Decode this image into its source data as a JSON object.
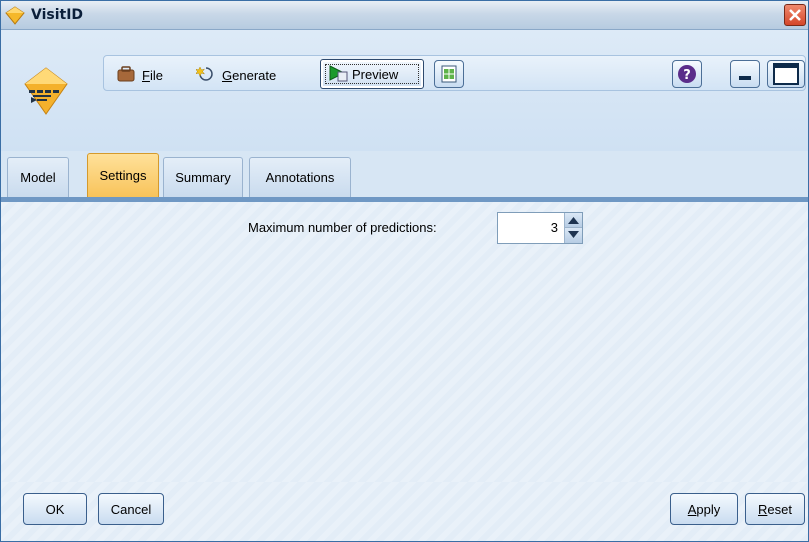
{
  "window": {
    "title": "VisitID"
  },
  "toolbar": {
    "file_label": "File",
    "file_mnemonic": "F",
    "file_rest": "ile",
    "generate_mnemonic": "G",
    "generate_rest": "enerate",
    "preview_mnemonic": "P",
    "preview_rest": "review"
  },
  "tabs": [
    {
      "label": "Model"
    },
    {
      "label": "Settings",
      "active": true
    },
    {
      "label": "Summary"
    },
    {
      "label": "Annotations"
    }
  ],
  "settings": {
    "max_predictions_label": "Maximum number of predictions:",
    "max_predictions_value": "3"
  },
  "buttons": {
    "ok": "OK",
    "cancel": "Cancel",
    "apply_mnemonic": "A",
    "apply_rest": "pply",
    "reset_mnemonic": "R",
    "reset_rest": "eset"
  },
  "icons": {
    "title": "model-nugget-icon",
    "close": "close-icon",
    "file": "file-icon",
    "generate": "generate-icon",
    "preview": "preview-icon",
    "export": "export-icon",
    "help": "help-icon",
    "minimize": "minimize-icon",
    "maximize": "maximize-icon"
  },
  "colors": {
    "active_tab": "#f8c35a",
    "tab_strip": "#6f98c4",
    "close_button": "#d4462a"
  }
}
